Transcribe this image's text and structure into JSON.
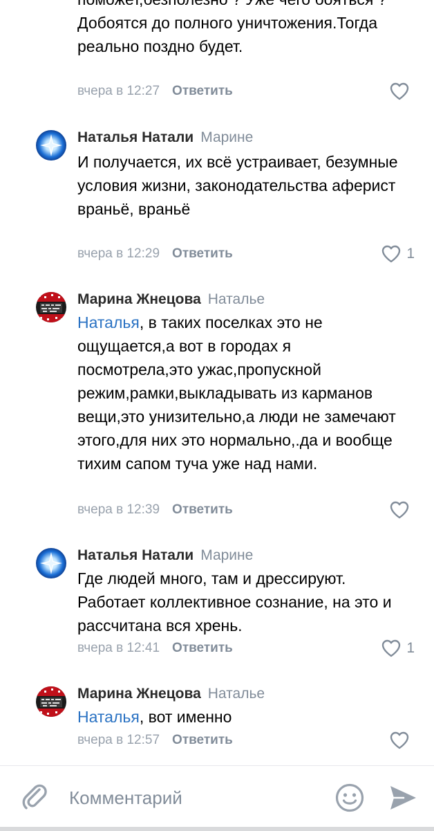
{
  "partial_comment": {
    "text": "поможет,безполезно ? Уже чего бояться ? Добоятся до полного уничтожения.Тогда реально поздно будет.",
    "time": "вчера в 12:27",
    "reply_label": "Ответить",
    "likes": ""
  },
  "comments": [
    {
      "author": "Наталья Натали",
      "reply_to": "Марине",
      "mention": "",
      "text": "И получается, их всё устраивает, безумные условия жизни, законодательства аферист враньё, враньё",
      "time": "вчера в 12:29",
      "reply_label": "Ответить",
      "likes": "1",
      "avatar": "blue-star-avatar"
    },
    {
      "author": "Марина Жнецова",
      "reply_to": "Наталье",
      "mention": "Наталья",
      "text": ", в таких поселках это не ощущается,а вот в городах я посмотрела,это ужас,пропускной режим,рамки,выкладывать из карманов вещи,это унизительно,а люди не замечают этого,для них это нормально,.да и вообще тихим сапом туча уже над нами.",
      "time": "вчера в 12:39",
      "reply_label": "Ответить",
      "likes": "",
      "avatar": "red-black-avatar"
    },
    {
      "author": "Наталья Натали",
      "reply_to": "Марине",
      "mention": "",
      "text": "Где людей много, там и дрессируют. Работает коллективное сознание, на это и рассчитана вся хрень.",
      "time": "вчера в 12:41",
      "reply_label": "Ответить",
      "likes": "1",
      "avatar": "blue-star-avatar"
    },
    {
      "author": "Марина Жнецова",
      "reply_to": "Наталье",
      "mention": "Наталья",
      "text": ", вот именно",
      "time": "вчера в 12:57",
      "reply_label": "Ответить",
      "likes": "",
      "avatar": "red-black-avatar"
    }
  ],
  "composer": {
    "placeholder": "Комментарий",
    "icons": [
      "paperclip-icon",
      "emoji-icon",
      "send-icon"
    ]
  },
  "colors": {
    "link": "#2a72c3",
    "secondary": "#818c99",
    "time": "#99a2ad",
    "author": "#2b2b2b"
  }
}
